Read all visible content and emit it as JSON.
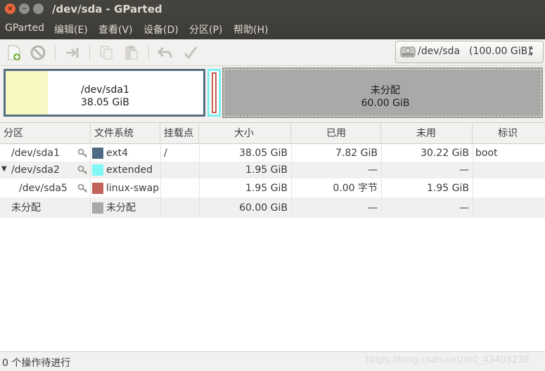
{
  "window": {
    "title": "/dev/sda - GParted",
    "close_glyph": "×",
    "min_glyph": "–"
  },
  "menu": [
    "GParted",
    "编辑(E)",
    "查看(V)",
    "设备(D)",
    "分区(P)",
    "帮助(H)"
  ],
  "toolbar": {
    "icons": [
      "new-partition-icon",
      "delete-partition-icon",
      "resize-move-icon",
      "copy-icon",
      "paste-icon",
      "undo-icon",
      "apply-icon"
    ]
  },
  "device_selector": {
    "device": "/dev/sda",
    "size": "(100.00 GiB)",
    "arrow": "▲▼"
  },
  "disk_map": {
    "sda1": {
      "name": "/dev/sda1",
      "size": "38.05 GiB"
    },
    "unallocated": {
      "name": "未分配",
      "size": "60.00 GiB"
    }
  },
  "table": {
    "headers": {
      "partition": "分区",
      "filesystem": "文件系统",
      "mountpoint": "挂载点",
      "size": "大小",
      "used": "已用",
      "unused": "未用",
      "flags": "标识"
    },
    "rows": [
      {
        "partition": "/dev/sda1",
        "filesystem": "ext4",
        "mountpoint": "/",
        "size": "38.05 GiB",
        "used": "7.82 GiB",
        "unused": "30.22 GiB",
        "flags": "boot"
      },
      {
        "partition": "/dev/sda2",
        "filesystem": "extended",
        "mountpoint": "",
        "size": "1.95 GiB",
        "used": "—",
        "unused": "—",
        "flags": "",
        "expander": "▼"
      },
      {
        "partition": "/dev/sda5",
        "filesystem": "linux-swap",
        "mountpoint": "",
        "size": "1.95 GiB",
        "used": "0.00 字节",
        "unused": "1.95 GiB",
        "flags": ""
      },
      {
        "partition": "未分配",
        "filesystem": "未分配",
        "mountpoint": "",
        "size": "60.00 GiB",
        "used": "—",
        "unused": "—",
        "flags": ""
      }
    ]
  },
  "colors": {
    "ext4": "#4f6a85",
    "extended": "#7ff7f7",
    "linux_swap": "#c1635a",
    "unallocated": "#a9a9a9",
    "used_space": "#f7f7c2"
  },
  "status": {
    "text": "0 个操作待进行",
    "watermark": "https://blog.csdn.net/m0_43403238"
  }
}
